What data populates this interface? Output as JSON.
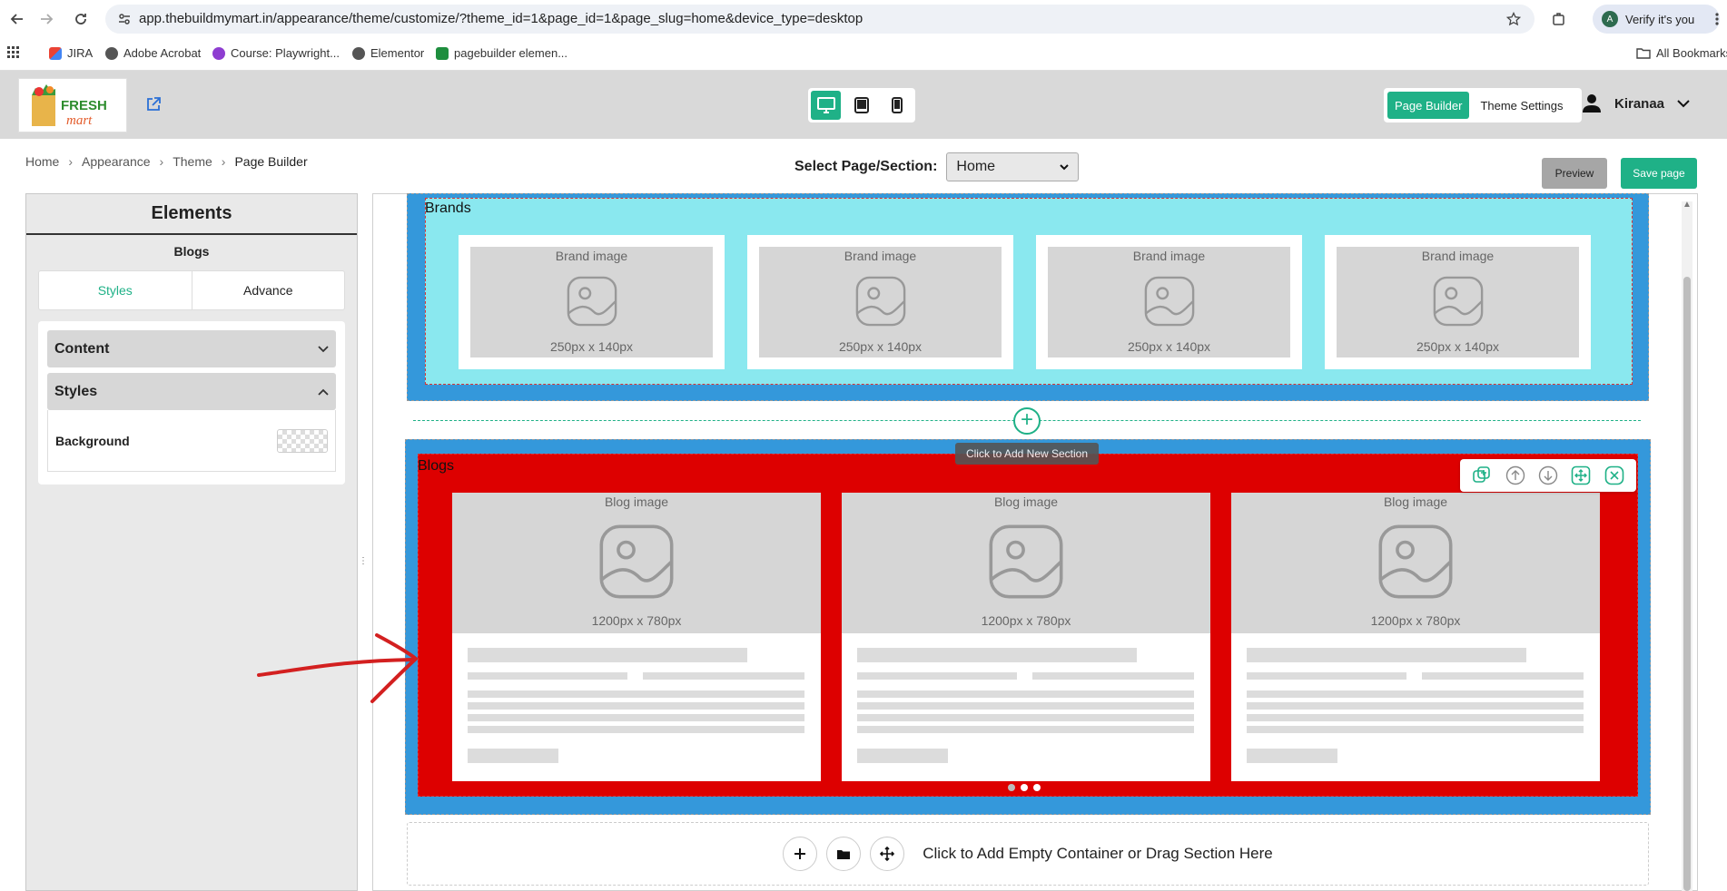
{
  "browser": {
    "url": "app.thebuildmymart.in/appearance/theme/customize/?theme_id=1&page_id=1&page_slug=home&device_type=desktop",
    "profile_label": "Verify it's you",
    "profile_initial": "A"
  },
  "bookmarks": [
    {
      "label": "JIRA",
      "icon": "gmail-icon"
    },
    {
      "label": "Adobe Acrobat",
      "icon": "globe-icon"
    },
    {
      "label": "Course: Playwright...",
      "icon": "course-icon"
    },
    {
      "label": "Elementor",
      "icon": "globe-icon"
    },
    {
      "label": "pagebuilder elemen...",
      "icon": "sheets-icon"
    }
  ],
  "all_bookmarks_label": "All Bookmarks",
  "header": {
    "logo_text_1": "FRESH",
    "logo_text_2": "mart",
    "modes": [
      "Page Builder",
      "Theme Settings"
    ],
    "user_name": "Kiranaa"
  },
  "breadcrumb": [
    "Home",
    "Appearance",
    "Theme",
    "Page Builder"
  ],
  "page_select": {
    "label": "Select Page/Section:",
    "value": "Home"
  },
  "actions": {
    "preview": "Preview",
    "save": "Save page"
  },
  "sidebar": {
    "title": "Elements",
    "subtitle": "Blogs",
    "tabs": [
      "Styles",
      "Advance"
    ],
    "accordions": [
      "Content",
      "Styles"
    ],
    "background_label": "Background"
  },
  "brands": {
    "title": "Brands",
    "card_label": "Brand image",
    "card_size": "250px x 140px",
    "count": 4
  },
  "add_section_tooltip": "Click to Add New Section",
  "blogs": {
    "title": "Blogs",
    "card_label": "Blog image",
    "card_size": "1200px x 780px",
    "count": 3
  },
  "empty_container_text": "Click to Add Empty Container or Drag Section Here",
  "colors": {
    "accent": "#1fb187",
    "section_blue": "#3498db",
    "brands_bg": "#8ae8ef",
    "blogs_bg": "#dd0000",
    "annotation_arrow": "#d32020"
  }
}
